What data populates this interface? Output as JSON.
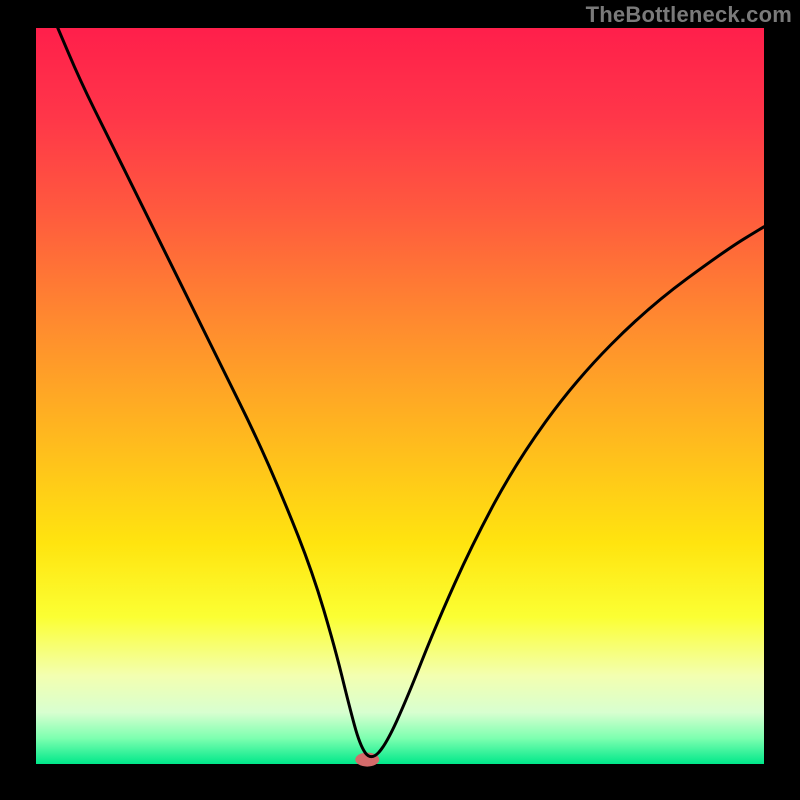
{
  "watermark": "TheBottleneck.com",
  "chart_data": {
    "type": "line",
    "title": "",
    "xlabel": "",
    "ylabel": "",
    "xlim": [
      0,
      100
    ],
    "ylim": [
      0,
      100
    ],
    "axes_visible": false,
    "grid": false,
    "background": {
      "type": "vertical-gradient",
      "stops": [
        {
          "pos": 0.0,
          "color": "#ff1f4b"
        },
        {
          "pos": 0.12,
          "color": "#ff3649"
        },
        {
          "pos": 0.25,
          "color": "#ff5a3e"
        },
        {
          "pos": 0.4,
          "color": "#ff8a2f"
        },
        {
          "pos": 0.55,
          "color": "#ffb71f"
        },
        {
          "pos": 0.7,
          "color": "#ffe40f"
        },
        {
          "pos": 0.8,
          "color": "#fbff33"
        },
        {
          "pos": 0.88,
          "color": "#f3ffb0"
        },
        {
          "pos": 0.93,
          "color": "#d8ffd0"
        },
        {
          "pos": 0.965,
          "color": "#7dffb0"
        },
        {
          "pos": 1.0,
          "color": "#00e88a"
        }
      ]
    },
    "series": [
      {
        "name": "bottleneck-curve",
        "color": "#000000",
        "stroke_width": 3,
        "x": [
          3,
          6,
          10,
          14,
          18,
          22,
          26,
          30,
          34,
          38,
          41,
          43,
          44.5,
          46,
          48,
          51,
          55,
          60,
          66,
          74,
          84,
          95,
          100
        ],
        "y_pct": [
          100,
          93,
          85,
          77,
          69,
          61,
          53,
          45,
          36,
          26,
          16,
          8,
          2.5,
          0.5,
          2.5,
          9,
          19,
          30,
          41,
          52,
          62,
          70,
          73
        ]
      }
    ],
    "marker": {
      "name": "current-point",
      "x": 45.5,
      "y_pct": 0.6,
      "rx": 12,
      "ry": 7,
      "fill": "#d46a6a"
    },
    "frame": {
      "outer_color": "#000000",
      "outer_width": 36,
      "inner_top_offset": 28
    }
  }
}
